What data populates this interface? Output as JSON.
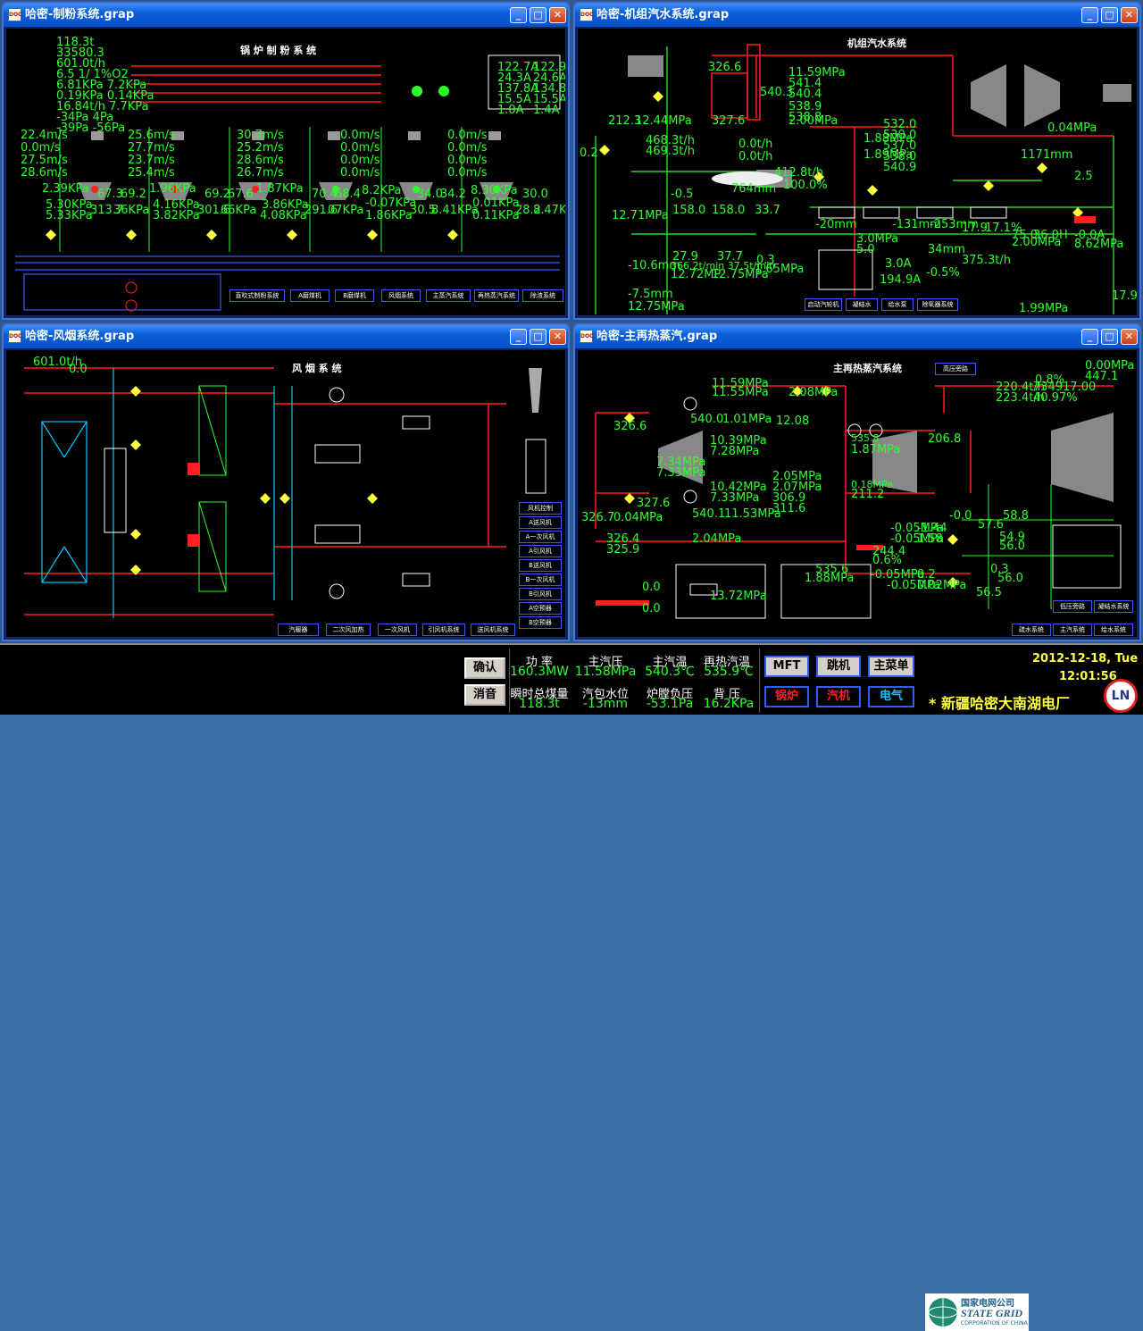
{
  "windows": {
    "w1": {
      "title": "哈密-制粉系统.grap",
      "panel_title": "锅 炉 制 粉 系 统"
    },
    "w2": {
      "title": "哈密-机组汽水系统.grap",
      "panel_title": "机组汽水系统"
    },
    "w3": {
      "title": "哈密-风烟系统.grap",
      "panel_title": "风 烟 系 统"
    },
    "w4": {
      "title": "哈密-主再热蒸汽.grap",
      "panel_title": "主再热蒸汽系统"
    }
  },
  "w1": {
    "left_values": [
      "118.3t",
      "33580.3",
      "601.0t/h",
      "6.5 1/ 1%O2",
      "6.81KPa 7.2KPa",
      "0.19KPa 0.14KPa",
      "16.84t/h 7.7KPa",
      "-34Pa 4Pa",
      "-39Pa -56Pa"
    ],
    "right_values": [
      "122.7A",
      "122.9A",
      "24.3A",
      "24.6A",
      "137.8A",
      "134.8A",
      "15.5A",
      "15.5A",
      "1.0A",
      "1.4A"
    ],
    "mill_vals": [
      "22.4m/s",
      "0.0m/s",
      "27.5m/s",
      "28.6m/s",
      "25.6m/s",
      "27.7m/s",
      "23.7m/s",
      "25.4m/s",
      "30.7m/s",
      "25.2m/s",
      "28.6m/s",
      "26.7m/s",
      "0.0m/s",
      "0.0m/s",
      "0.0m/s",
      "0.0m/s",
      "0.0m/s",
      "0.0m/s",
      "0.0m/s",
      "0.0m/s"
    ],
    "row2": [
      "2.39KPa",
      "67.3",
      "69.2",
      "1.96KPa",
      "69.2",
      "67.6",
      "1.87KPa",
      "70.4",
      "68.4",
      "8.2KPa",
      "34.0",
      "34.2",
      "8.30KPa",
      "30.0"
    ],
    "row3": [
      "5.30KPa",
      "313.7",
      "36KPa",
      "4.16KPa",
      "301.6",
      "66KPa",
      "3.86KPa",
      "291.6",
      "07KPa",
      "-0.07KPa",
      "30.5",
      "8.41KPa",
      "0.01KPa",
      "28.2",
      "8.47KPa"
    ],
    "row4": [
      "5.33KPa",
      "3.82KPa",
      "4.08KPa",
      "1.86KPa",
      "0.11KPa"
    ],
    "nav": [
      "直吹式制粉系统",
      "A磨煤机",
      "B磨煤机",
      "风烟系统",
      "主蒸汽系统",
      "再热蒸汽系统",
      "除渣系统"
    ]
  },
  "w2": {
    "vals": [
      "326.6",
      "540.3",
      "327.6",
      "11.59MPa",
      "541.4",
      "540.4",
      "538.9",
      "538.8",
      "2.00MPa",
      "212.3",
      "12.44MPa",
      "468.3t/h",
      "469.3t/h",
      "0.2",
      "0.0t/h",
      "0.0t/h",
      "412.8t/h",
      "100.0%",
      "764mm",
      "-0.5",
      "12.71MPa",
      "158.0",
      "158.0",
      "33.7",
      "-20mm",
      "-131mm",
      "-253mm",
      "3.0MPa",
      "5.0",
      "34mm",
      "3.0A",
      "194.9A",
      "375.3t/h",
      "-0.5%",
      "27.9",
      "37.7",
      "0.3",
      "12.72MP",
      "12.75MPa",
      "1.65MPa",
      "366.2t/min 37.5t/min",
      "-10.6mm",
      "-7.5mm",
      "12.75MPa",
      "532.0",
      "530.0",
      "537.0",
      "538.0",
      "540.9",
      "1.88MPa",
      "1.89MPa",
      "0.04MPa",
      "1171mm",
      "2.5",
      "17.9",
      "17.1%",
      "75.0",
      "36.0H",
      "-0.0A",
      "2.00MPa",
      "8.62MPa",
      "1.99MPa",
      "17.9"
    ],
    "nav": [
      "启动汽轮机",
      "凝结水",
      "给水泵",
      "除氧器系统"
    ]
  },
  "w3": {
    "vals": [
      "601.0t/h",
      "0.0"
    ],
    "nav": [
      "汽暖器",
      "二次风加热",
      "一次风机",
      "引风机系统",
      "送风机系统"
    ],
    "side_nav": [
      "风机控制",
      "A送风机",
      "A一次风机",
      "A引风机",
      "B送风机",
      "B一次风机",
      "B引风机",
      "A空预器",
      "B空预器"
    ]
  },
  "w4": {
    "vals": [
      "11.59MPa",
      "11.55MPa",
      "2.08MPa",
      "326.6",
      "12.08",
      "540.0",
      "1.01MPa",
      "7.34MPa",
      "7.33MPa",
      "10.39MPa",
      "7.28MPa",
      "10.42MPa",
      "7.33MPa",
      "327.6",
      "326.7",
      "0.04MPa",
      "540.1",
      "11.53MPa",
      "2.05MPa",
      "2.07MPa",
      "306.9",
      "311.6",
      "326.4",
      "325.9",
      "2.04MPa",
      "13.72MPa",
      "0.0",
      "0.0",
      "535.6",
      "1.88MPa",
      "535.8",
      "1.87MPa",
      "0.18MPa",
      "211.2",
      "206.8",
      "220.4t/h",
      "223.4t/h",
      "734917.00",
      "40.97%",
      "0.00MPa",
      "447.1",
      "0.8%",
      "-0.05MPa",
      "-0.05MPa",
      "-1.44",
      "1.58",
      "244.4",
      "0.6%",
      "-0.05MPa",
      "-0.05MPa",
      "0.2",
      "0.02MPa",
      "-0.0",
      "57.6",
      "58.8",
      "54.9",
      "56.0",
      "0.3",
      "56.0",
      "56.5"
    ],
    "nav": [
      "高压旁路",
      "低压旁路",
      "凝结水系统",
      "主汽系统",
      "给水系统",
      "疏水系统"
    ]
  },
  "status": {
    "confirm_label": "确认",
    "mute_label": "消音",
    "metrics": [
      {
        "label": "功 率",
        "value": "160.3MW"
      },
      {
        "label": "主汽压",
        "value": "11.58MPa"
      },
      {
        "label": "主汽温",
        "value": "540.3℃"
      },
      {
        "label": "再热汽温",
        "value": "535.9℃"
      },
      {
        "label": "瞬时总煤量",
        "value": "118.3t"
      },
      {
        "label": "汽包水位",
        "value": "-13mm"
      },
      {
        "label": "炉膛负压",
        "value": "-53.1Pa"
      },
      {
        "label": "背 压",
        "value": "16.2KPa"
      }
    ],
    "mft_label": "MFT",
    "trip_label": "跳机",
    "main_menu_label": "主菜单",
    "boiler_label": "锅炉",
    "turbine_label": "汽机",
    "electric_label": "电气",
    "logo_cn": "国家电网公司",
    "logo_en": "STATE GRID",
    "logo_sub": "CORPORATION OF CHINA",
    "date": "2012-12-18, Tue",
    "time": "12:01:56",
    "plant_name": "* 新疆哈密大南湖电厂",
    "ln_logo": "LN"
  },
  "colors": {
    "green": "#2cff2c",
    "red": "#ff2020",
    "blue": "#2f5cff",
    "yellow": "#ffff40"
  }
}
